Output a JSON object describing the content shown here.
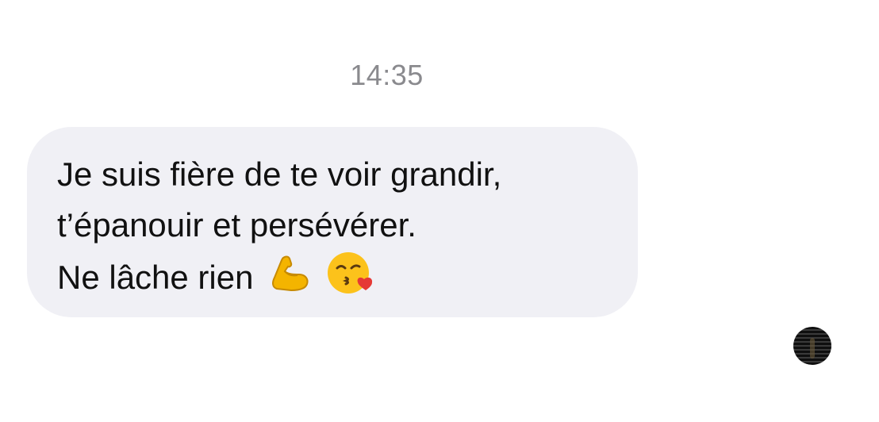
{
  "timestamp": "14:35",
  "message": {
    "lines": [
      "Je suis fière de te voir grandir,",
      "t’épanouir et persévérer.",
      "Ne lâche rien"
    ],
    "emojis": [
      "flexed-biceps",
      "face-blowing-kiss"
    ],
    "bubble_color": "#f0f0f5",
    "text_color": "#111111"
  },
  "avatar": {
    "icon": "contact-avatar-photo"
  }
}
